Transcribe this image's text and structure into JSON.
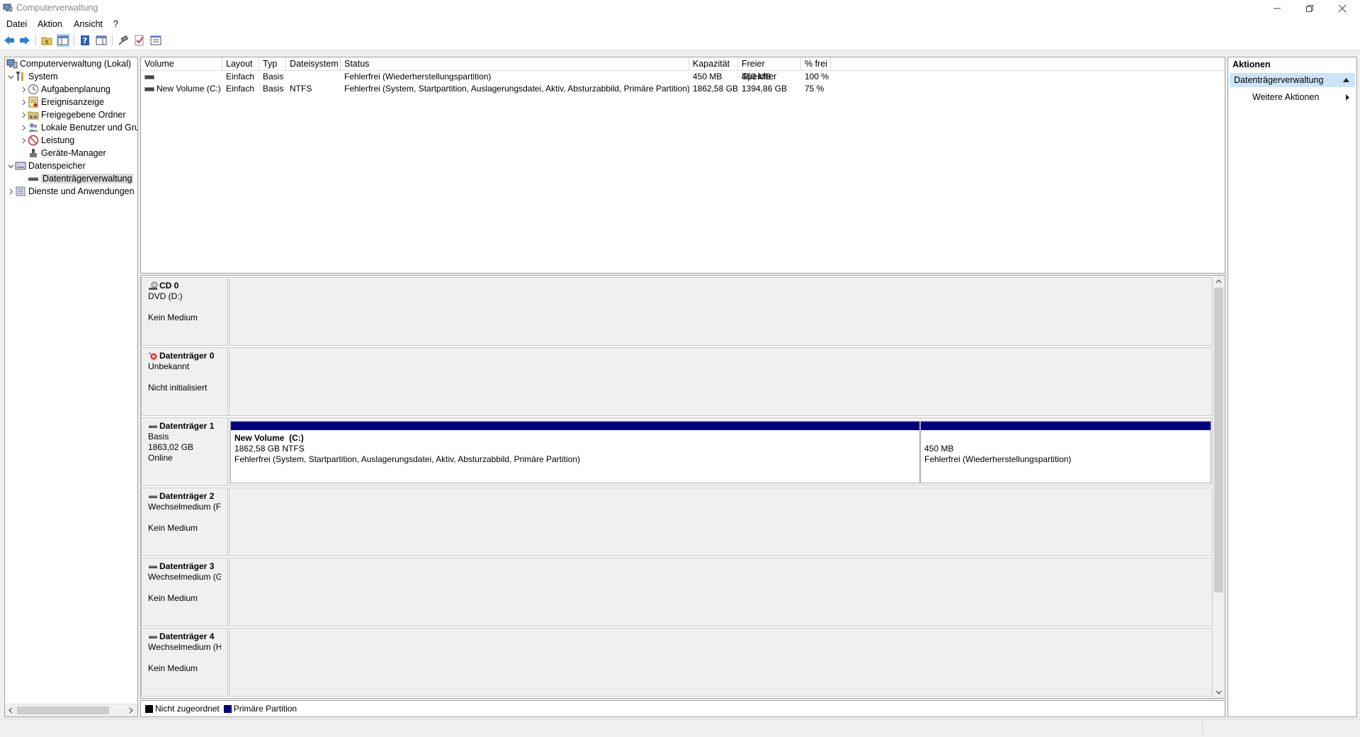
{
  "window": {
    "title": "Computerverwaltung"
  },
  "menu": [
    "Datei",
    "Aktion",
    "Ansicht",
    "?"
  ],
  "tree": {
    "root": "Computerverwaltung (Lokal)",
    "system": "System",
    "aufgaben": "Aufgabenplanung",
    "ereignis": "Ereignisanzeige",
    "ordner": "Freigegebene Ordner",
    "benutzer": "Lokale Benutzer und Gruppen",
    "leistung": "Leistung",
    "geraete": "Geräte-Manager",
    "speicher": "Datenspeicher",
    "datentraeger": "Datenträgerverwaltung",
    "dienste": "Dienste und Anwendungen"
  },
  "volumes": {
    "headers": [
      "Volume",
      "Layout",
      "Typ",
      "Dateisystem",
      "Status",
      "Kapazität",
      "Freier Speicher",
      "% frei"
    ],
    "rows": [
      {
        "volume": "",
        "layout": "Einfach",
        "typ": "Basis",
        "fs": "",
        "status": "Fehlerfrei (Wiederherstellungspartition)",
        "kap": "450 MB",
        "frei": "450 MB",
        "pct": "100 %"
      },
      {
        "volume": "New Volume (C:)",
        "layout": "Einfach",
        "typ": "Basis",
        "fs": "NTFS",
        "status": "Fehlerfrei (System, Startpartition, Auslagerungsdatei, Aktiv, Absturzabbild, Primäre Partition)",
        "kap": "1862,58 GB",
        "frei": "1394,86 GB",
        "pct": "75 %"
      }
    ]
  },
  "disks": [
    {
      "name": "CD 0",
      "l1": "DVD (D:)",
      "l2": "",
      "l3": "Kein Medium"
    },
    {
      "name": "Datenträger 0",
      "l1": "Unbekannt",
      "l2": "",
      "l3": "Nicht initialisiert"
    },
    {
      "name": "Datenträger 1",
      "l1": "Basis",
      "l2": "1863,02 GB",
      "l3": "Online",
      "partitions": [
        {
          "title": "New Volume  (C:)",
          "size": "1862,58 GB NTFS",
          "status": "Fehlerfrei (System, Startpartition, Auslagerungsdatei, Aktiv, Absturzabbild, Primäre Partition)"
        },
        {
          "title": "",
          "size": "450 MB",
          "status": "Fehlerfrei (Wiederherstellungspartition)"
        }
      ]
    },
    {
      "name": "Datenträger 2",
      "l1": "Wechselmedium (F:)",
      "l2": "",
      "l3": "Kein Medium"
    },
    {
      "name": "Datenträger 3",
      "l1": "Wechselmedium (G:)",
      "l2": "",
      "l3": "Kein Medium"
    },
    {
      "name": "Datenträger 4",
      "l1": "Wechselmedium (H:)",
      "l2": "",
      "l3": "Kein Medium"
    }
  ],
  "legend": {
    "unallocated": "Nicht zugeordnet",
    "primary": "Primäre Partition",
    "unallocated_color": "#000000",
    "primary_color": "#00007f"
  },
  "actions": {
    "title": "Aktionen",
    "section": "Datenträgerverwaltung",
    "more": "Weitere Aktionen"
  }
}
